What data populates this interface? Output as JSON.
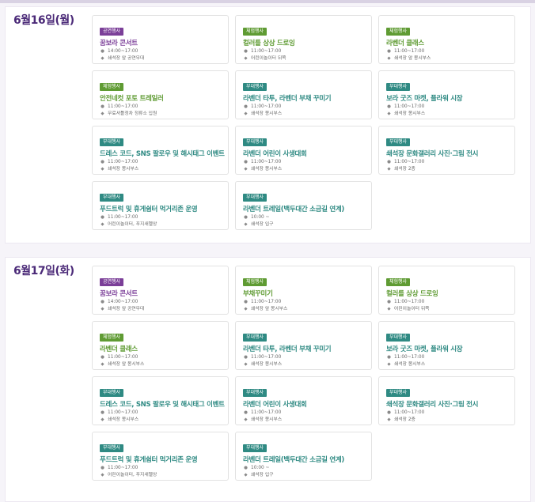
{
  "days": [
    {
      "date": "6월16일(월)",
      "events": [
        {
          "category": "공연행사",
          "type": "perf",
          "title": "꿈보라 콘서트",
          "time": "14:00~17:00",
          "place": "쇄석장 앞 공연무대"
        },
        {
          "category": "체험행사",
          "type": "exp",
          "title": "컬러를 상상 드로잉",
          "time": "11:00~17:00",
          "place": "어린이놀이터 뒤쪽"
        },
        {
          "category": "체험행사",
          "type": "exp",
          "title": "라벤더 클래스",
          "time": "11:00~17:00",
          "place": "쇄석장 앞 몽시부스"
        },
        {
          "category": "체험행사",
          "type": "exp",
          "title": "안전네컷 포토 트레일러",
          "time": "11:00~17:00",
          "place": "무료셔틀정차 정류소 입원"
        },
        {
          "category": "부대행사",
          "type": "side",
          "title": "라벤더 타투, 라벤더 부채 꾸미기",
          "time": "11:00~17:00",
          "place": "쇄석장 몽시부스"
        },
        {
          "category": "부대행사",
          "type": "side",
          "title": "보라 굿즈 마켓, 플라워 시장",
          "time": "11:00~17:00",
          "place": "쇄석장 몽시부스"
        },
        {
          "category": "부대행사",
          "type": "side",
          "title": "드레스 코드, SNS 팔로우 및 해시태그 이벤트",
          "time": "11:00~17:00",
          "place": "쇄석장 몽시부스"
        },
        {
          "category": "부대행사",
          "type": "side",
          "title": "라벤더 어린이 사생대회",
          "time": "11:00~17:00",
          "place": "쇄석장 몽시부스"
        },
        {
          "category": "부대행사",
          "type": "side",
          "title": "쇄석장 문화갤러리 사진·그림 전시",
          "time": "11:00~17:00",
          "place": "쇄석장 2층"
        },
        {
          "category": "부대행사",
          "type": "side",
          "title": "푸드트럭 및 휴게쉼터 먹거리존 운영",
          "time": "11:00~17:00",
          "place": "어린이놀이터, 푸지새멜앙"
        },
        {
          "category": "부대행사",
          "type": "side",
          "title": "라벤더 트레일(백두대간 소금길 연계)",
          "time": "10:00 ~",
          "place": "쇄석장 입구"
        }
      ]
    },
    {
      "date": "6월17일(화)",
      "events": [
        {
          "category": "공연행사",
          "type": "perf",
          "title": "꿈보라 콘서트",
          "time": "14:00~17:00",
          "place": "쇄석장 앞 공연무대"
        },
        {
          "category": "체험행사",
          "type": "exp",
          "title": "부채꾸미기",
          "time": "11:00~17:00",
          "place": "쇄석장 앞 몽시부스"
        },
        {
          "category": "체험행사",
          "type": "exp",
          "title": "컬러를 상상 드로잉",
          "time": "11:00~17:00",
          "place": "어린이놀이터 뒤쪽"
        },
        {
          "category": "체험행사",
          "type": "exp",
          "title": "라벤더 클래스",
          "time": "11:00~17:00",
          "place": "쇄석장 앞 몽시부스"
        },
        {
          "category": "부대행사",
          "type": "side",
          "title": "라벤더 타투, 라벤더 부채 꾸미기",
          "time": "11:00~17:00",
          "place": "쇄석장 몽시부스"
        },
        {
          "category": "부대행사",
          "type": "side",
          "title": "보라 굿즈 마켓, 플라워 시장",
          "time": "11:00~17:00",
          "place": "쇄석장 몽시부스"
        },
        {
          "category": "부대행사",
          "type": "side",
          "title": "드레스 코드, SNS 팔로우 및 해시태그 이벤트",
          "time": "11:00~17:00",
          "place": "쇄석장 몽시부스"
        },
        {
          "category": "부대행사",
          "type": "side",
          "title": "라벤더 어린이 사생대회",
          "time": "11:00~17:00",
          "place": "쇄석장 몽시부스"
        },
        {
          "category": "부대행사",
          "type": "side",
          "title": "쇄석장 문화갤러리 사진·그림 전시",
          "time": "11:00~17:00",
          "place": "쇄석장 2층"
        },
        {
          "category": "부대행사",
          "type": "side",
          "title": "푸드트럭 및 휴게쉼터 먹거리존 운영",
          "time": "11:00~17:00",
          "place": "어린이놀이터, 푸지새멜앙"
        },
        {
          "category": "부대행사",
          "type": "side",
          "title": "라벤더 트레일(백두대간 소금길 연계)",
          "time": "10:00 ~",
          "place": "쇄석장 입구"
        }
      ]
    }
  ],
  "icons": {
    "time": "clock-icon",
    "place": "location-diamond-icon"
  },
  "colors": {
    "performance": "#7b3f98",
    "experience": "#5f9b33",
    "side_event": "#2f8a83",
    "date_title": "#4b2a78"
  }
}
